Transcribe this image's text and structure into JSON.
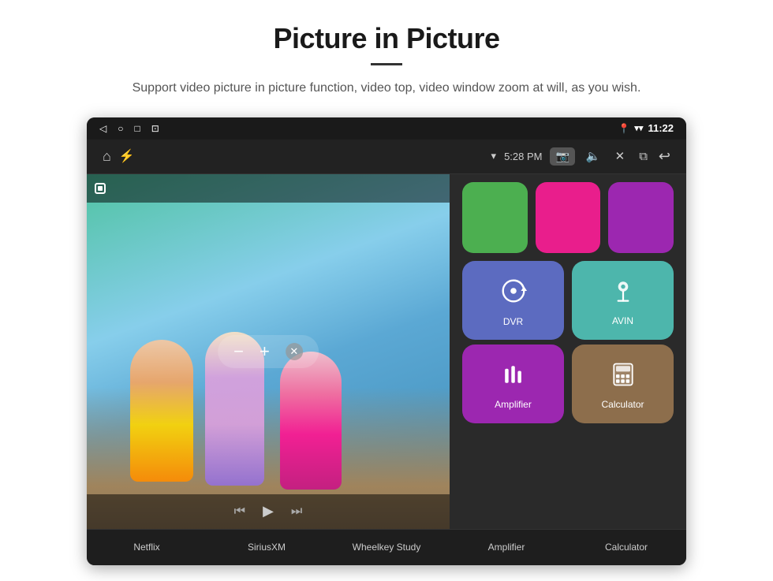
{
  "page": {
    "title": "Picture in Picture",
    "subtitle": "Support video picture in picture function, video top, video window zoom at will, as you wish."
  },
  "status_bar": {
    "left_icons": [
      "◁",
      "○",
      "□",
      "⊡"
    ],
    "right_time": "11:22"
  },
  "nav_bar": {
    "time": "5:28 PM",
    "wifi_icon": "wifi",
    "camera_icon": "📷",
    "volume_icon": "🔊",
    "close_icon": "✕",
    "pip_icon": "⧉",
    "back_icon": "↩"
  },
  "pip": {
    "minus_label": "−",
    "plus_label": "+",
    "close_label": "✕",
    "prev_label": "⏮",
    "play_label": "▶",
    "next_label": "⏭"
  },
  "apps": {
    "top_row": [
      {
        "color": "green",
        "label": ""
      },
      {
        "color": "pink",
        "label": ""
      },
      {
        "color": "purple",
        "label": ""
      }
    ],
    "main_rows": [
      [
        {
          "id": "dvr",
          "color": "blue",
          "label": "DVR"
        },
        {
          "id": "avin",
          "color": "teal",
          "label": "AVIN"
        }
      ],
      [
        {
          "id": "amplifier",
          "color": "purple2",
          "label": "Amplifier"
        },
        {
          "id": "calculator",
          "color": "brown",
          "label": "Calculator"
        }
      ]
    ]
  },
  "bottom_labels": [
    "Netflix",
    "SiriusXM",
    "Wheelkey Study",
    "Amplifier",
    "Calculator"
  ]
}
